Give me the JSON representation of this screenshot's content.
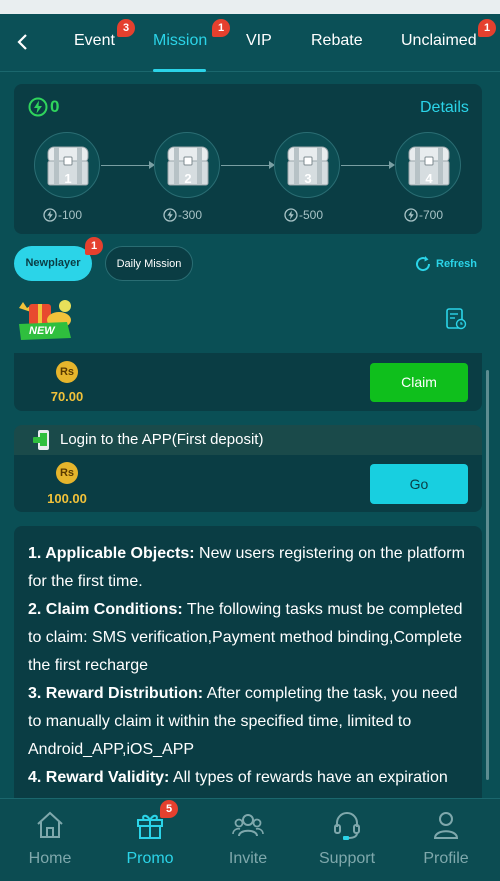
{
  "tabs": {
    "back_icon": "chevron-left-icon",
    "items": [
      {
        "label": "Event",
        "badge": "3"
      },
      {
        "label": "Mission",
        "badge": "1",
        "active": true
      },
      {
        "label": "VIP"
      },
      {
        "label": "Rebate"
      },
      {
        "label": "Unclaimed",
        "badge": "1"
      }
    ]
  },
  "progress": {
    "energy_value": "0",
    "details_label": "Details",
    "chests": [
      {
        "number": "1",
        "cost": "-100"
      },
      {
        "number": "2",
        "cost": "-300"
      },
      {
        "number": "3",
        "cost": "-500"
      },
      {
        "number": "4",
        "cost": "-700"
      }
    ]
  },
  "filters": {
    "newplayer_label": "Newplayer",
    "newplayer_badge": "1",
    "daily_label": "Daily Mission",
    "refresh_label": "Refresh"
  },
  "tasks": [
    {
      "currency": "Rs",
      "amount": "70.00",
      "button": "Claim"
    },
    {
      "title": "Login to the APP(First deposit)",
      "currency": "Rs",
      "amount": "100.00",
      "button": "Go"
    }
  ],
  "new_label": "NEW",
  "description": {
    "items": [
      {
        "heading": "1. Applicable Objects:",
        "text": "New users registering on the platform for the first time."
      },
      {
        "heading": "2. Claim Conditions:",
        "text": "The following tasks must be completed to claim: SMS verification,Payment method binding,Complete the first recharge"
      },
      {
        "heading": "3. Reward Distribution:",
        "text": "After completing the task, you need to manually claim it within the specified time, limited to Android_APP,iOS_APP"
      },
      {
        "heading": "4. Reward Validity:",
        "text": "All types of rewards have an expiration date. Please claim or use them within the"
      }
    ]
  },
  "bottom_nav": [
    {
      "label": "Home",
      "icon": "home-icon"
    },
    {
      "label": "Promo",
      "icon": "gift-icon",
      "badge": "5",
      "active": true
    },
    {
      "label": "Invite",
      "icon": "invite-icon"
    },
    {
      "label": "Support",
      "icon": "support-icon"
    },
    {
      "label": "Profile",
      "icon": "profile-icon"
    }
  ],
  "colors": {
    "background": "#0a4f55",
    "panel": "#0a3d44",
    "accent": "#2bd4e8",
    "claim_green": "#0fbf1c",
    "go_cyan": "#18cfe0",
    "badge_red": "#e5402e",
    "energy_green": "#2fd45c",
    "coin_gold": "#e6b52c"
  }
}
